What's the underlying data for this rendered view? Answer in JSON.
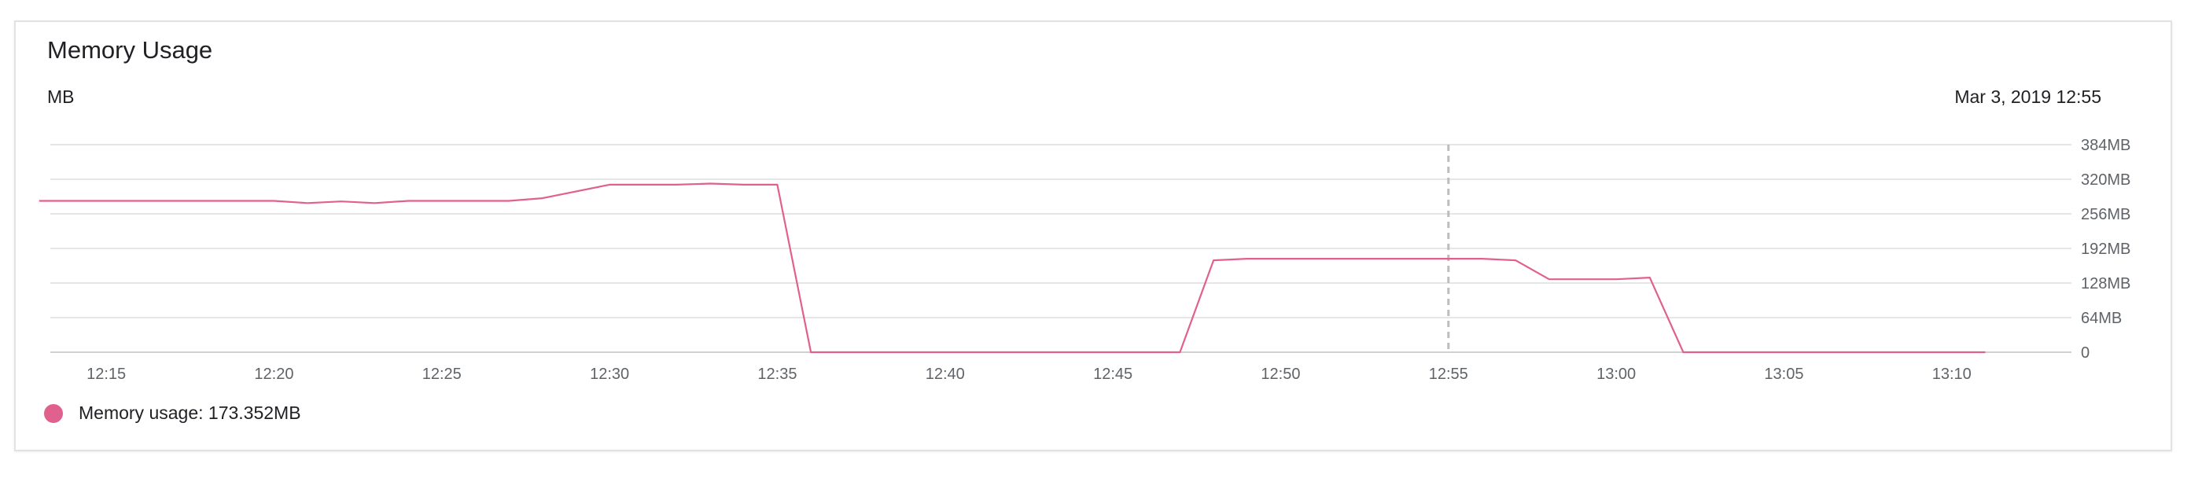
{
  "card": {
    "title": "Memory Usage",
    "unit": "MB",
    "hover_date": "Mar 3, 2019 12:55"
  },
  "legend": {
    "text": "Memory usage: 173.352MB",
    "color": "#e0608e"
  },
  "chart_data": {
    "type": "line",
    "title": "Memory Usage",
    "ylabel": "MB",
    "x_tick_labels": [
      "12:15",
      "12:20",
      "12:25",
      "12:30",
      "12:35",
      "12:40",
      "12:45",
      "12:50",
      "12:55",
      "13:00",
      "13:05",
      "13:10"
    ],
    "y_tick_labels": [
      "0",
      "64MB",
      "128MB",
      "192MB",
      "256MB",
      "320MB",
      "384MB"
    ],
    "y_tick_values": [
      0,
      64,
      128,
      192,
      256,
      320,
      384
    ],
    "ylim": [
      0,
      384
    ],
    "xlim": [
      "12:13:20",
      "13:13:20"
    ],
    "grid": true,
    "hover_marker_x": "12:55",
    "series": [
      {
        "name": "Memory usage",
        "color": "#e0608e",
        "points": [
          [
            "12:13",
            280
          ],
          [
            "12:20",
            280
          ],
          [
            "12:21",
            276
          ],
          [
            "12:22",
            279
          ],
          [
            "12:23",
            276
          ],
          [
            "12:24",
            280
          ],
          [
            "12:27",
            280
          ],
          [
            "12:28",
            285
          ],
          [
            "12:30",
            310
          ],
          [
            "12:32",
            310
          ],
          [
            "12:33",
            312
          ],
          [
            "12:34",
            310
          ],
          [
            "12:35",
            310
          ],
          [
            "12:36",
            0
          ],
          [
            "12:47",
            0
          ],
          [
            "12:48",
            170
          ],
          [
            "12:49",
            173
          ],
          [
            "12:56",
            173
          ],
          [
            "12:57",
            170
          ],
          [
            "12:58",
            135
          ],
          [
            "13:00",
            135
          ],
          [
            "13:01",
            138
          ],
          [
            "13:02",
            0
          ],
          [
            "13:11",
            0
          ]
        ]
      }
    ]
  }
}
